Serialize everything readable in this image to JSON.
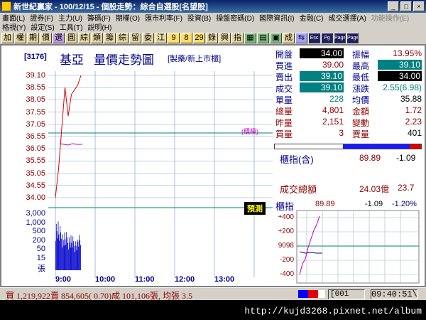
{
  "window": {
    "title": "新世紀贏家 - 100/12/15 - 個股走勢：綜合自選股[名望股]"
  },
  "menu_row1": [
    "畫面(L)",
    "證券(F)",
    "主力(U)",
    "籌碼(F)",
    "期權(O)",
    "匯市利率(F)",
    "投資(B)",
    "操盤密碼(D)",
    "國際資訊(I)",
    "金融(C)",
    "成交選擇(A)",
    "功能操作(E)"
  ],
  "menu_row2": [
    "格視(Y)",
    "設定(S)",
    "工具(T)",
    "說明(H)"
  ],
  "toolbar": [
    "加",
    "權",
    "期",
    "價",
    "選",
    "圓",
    "綜",
    "類",
    "籌",
    "綜",
    "留",
    "委",
    "江",
    "9",
    "8",
    "29",
    "錄",
    "興",
    "指",
    "▦",
    "▤",
    "▣",
    "成",
    "⇆",
    "Esc",
    "Pg",
    "Page",
    "Page"
  ],
  "header": {
    "code": "[3176]",
    "name": "基亞",
    "title": "量價走勢圖",
    "category": "[製藥/新上市櫃]"
  },
  "price_axis": [
    "39.10",
    "38.55",
    "38.05",
    "37.55",
    "37.05",
    "36.55",
    "36.05",
    "35.55",
    "35.05",
    "34.55",
    "34.00"
  ],
  "volume_axis": [
    "3,000",
    "1,000",
    "500",
    "200",
    "50",
    "15",
    "張"
  ],
  "time_axis": [
    "9:00",
    "10:00",
    "11:00",
    "12:00",
    "13:00"
  ],
  "ref_label": "(穩檯)",
  "forecast_label": "預測",
  "quote": {
    "open_k": "開盤",
    "open_v": "34.00",
    "amp_k": "振幅",
    "amp_v": "13.95%",
    "bid_k": "買進",
    "bid_v": "39.00",
    "high_k": "最高",
    "high_v": "39.10",
    "ask_k": "賣出",
    "ask_v": "39.10",
    "low_k": "最低",
    "low_v": "34.00",
    "deal_k": "成交",
    "deal_v": "39.10",
    "chg_k": "漲跌",
    "chg_v": "2.55(6.98)",
    "unit_k": "單量",
    "unit_v": "228",
    "avg_k": "均價",
    "avg_v": "35.88",
    "total_k": "總量",
    "total_v": "4,801",
    "amt_k": "金額",
    "amt_v": "1.72",
    "yest_k": "昨量",
    "yest_v": "2,151",
    "turn_k": "變動",
    "turn_v": "2.23",
    "buy_k": "買量",
    "buy_v": "3",
    "sell_k": "賣量",
    "sell_v": "401"
  },
  "index_box": {
    "label": "櫃指(含)",
    "value": "89.89",
    "change": "-1.09",
    "total_label": "成交總額",
    "total_value": "24.03億",
    "total_change": "23.7"
  },
  "mini": {
    "label": "櫃指",
    "value": "89.89",
    "change": "-1.09",
    "pct": "-1.20%",
    "axis": [
      "+400",
      "+200",
      "9098",
      "-200",
      "-400"
    ]
  },
  "status": {
    "summary": "買 1,219,922賣 854,605( 0.70)成 101,106張, 均張 3.5",
    "code": "[001",
    "time": "09:40:51\\"
  },
  "watermark": "http://kujd3268.pixnet.net/album",
  "chart_data": {
    "type": "line",
    "title": "量價走勢圖",
    "x": [
      "9:00",
      "9:05",
      "9:10",
      "9:15",
      "9:20",
      "9:25",
      "9:30",
      "9:35",
      "9:40"
    ],
    "series": [
      {
        "values": [
          34.0,
          35.2,
          36.9,
          38.6,
          37.4,
          38.3,
          38.5,
          38.7,
          39.1
        ]
      }
    ],
    "ylim": [
      34.0,
      39.1
    ],
    "volume": [
      3000,
      1000,
      500,
      400,
      300,
      200,
      150,
      250,
      600
    ],
    "xlim": [
      "9:00",
      "13:30"
    ],
    "ref_price": 36.55
  }
}
